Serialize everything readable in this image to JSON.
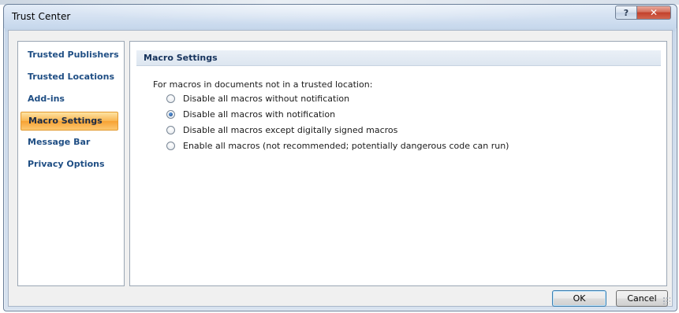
{
  "window": {
    "title": "Trust Center",
    "help_glyph": "?",
    "close_glyph": "✕"
  },
  "nav": {
    "items": [
      {
        "label": "Trusted Publishers",
        "selected": false
      },
      {
        "label": "Trusted Locations",
        "selected": false
      },
      {
        "label": "Add-ins",
        "selected": false
      },
      {
        "label": "Macro Settings",
        "selected": true
      },
      {
        "label": "Message Bar",
        "selected": false
      },
      {
        "label": "Privacy Options",
        "selected": false
      }
    ]
  },
  "macro_settings": {
    "header": "Macro Settings",
    "group_label": "For macros in documents not in a trusted location:",
    "options": [
      {
        "label": "Disable all macros without notification",
        "checked": false
      },
      {
        "label": "Disable all macros with notification",
        "checked": true
      },
      {
        "label": "Disable all macros except digitally signed macros",
        "checked": false
      },
      {
        "label": "Enable all macros (not recommended; potentially dangerous code can run)",
        "checked": false
      }
    ]
  },
  "buttons": {
    "ok": "OK",
    "cancel": "Cancel"
  },
  "colors": {
    "nav_text": "#1f4e84",
    "selection_orange": "#f7a233",
    "header_text": "#15325c",
    "close_red": "#c2402b"
  },
  "icons": [
    "help-icon",
    "close-icon",
    "radio-selected-icon",
    "radio-unselected-icon",
    "resize-grip-icon"
  ]
}
